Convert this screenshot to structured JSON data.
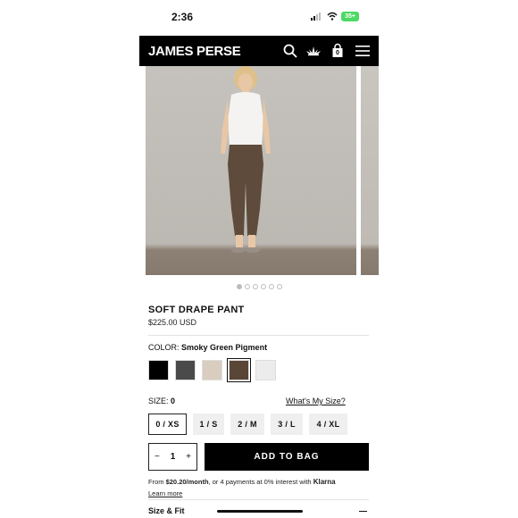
{
  "status_bar": {
    "time": "2:36",
    "battery": "35+"
  },
  "header": {
    "logo": "JAMES PERSE",
    "icons": [
      "search-icon",
      "lotus-icon",
      "bag-icon",
      "menu-icon"
    ],
    "bag_count": "0"
  },
  "gallery": {
    "dot_count": 6,
    "active_dot": 1
  },
  "product": {
    "title": "SOFT DRAPE PANT",
    "price": "$225.00 USD",
    "color_label": "COLOR:",
    "color_value": "Smoky Green Pigment",
    "swatches": [
      {
        "name": "black",
        "hex": "#000000",
        "selected": false
      },
      {
        "name": "charcoal",
        "hex": "#4a4a4a",
        "selected": false
      },
      {
        "name": "beige",
        "hex": "#d8cdbf",
        "selected": false
      },
      {
        "name": "smoky-green-pigment",
        "hex": "#5a4636",
        "selected": true
      },
      {
        "name": "white",
        "hex": "#ececec",
        "selected": false
      }
    ],
    "size_label": "SIZE:",
    "size_value": "0",
    "whats_my_size": "What's My Size?",
    "sizes": [
      {
        "label": "0 / XS",
        "selected": true
      },
      {
        "label": "1 / S",
        "selected": false
      },
      {
        "label": "2 / M",
        "selected": false
      },
      {
        "label": "3 / L",
        "selected": false
      },
      {
        "label": "4 / XL",
        "selected": false
      }
    ],
    "quantity": "1",
    "quantity_minus": "−",
    "quantity_plus": "+",
    "add_to_bag": "ADD TO BAG",
    "klarna_prefix": "From",
    "klarna_amount": "$20.20/month",
    "klarna_suffix": ", or 4 payments at 0% interest with",
    "klarna_brand": "Klarna",
    "learn_more": "Learn more",
    "size_fit": "Size & Fit"
  }
}
